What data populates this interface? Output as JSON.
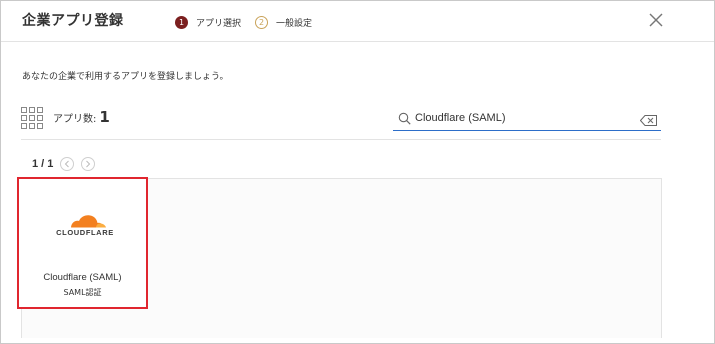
{
  "header": {
    "title": "企業アプリ登録",
    "steps": [
      {
        "num": "1",
        "label": "アプリ選択"
      },
      {
        "num": "2",
        "label": "一般設定"
      }
    ]
  },
  "main": {
    "description": "あなたの企業で利用するアプリを登録しましょう。",
    "app_count_label": "アプリ数:",
    "app_count": "1",
    "search": {
      "value": "Cloudflare (SAML)",
      "placeholder": ""
    },
    "pager": {
      "text": "1 / 1"
    },
    "apps": [
      {
        "logo_text": "CLOUDFLARE",
        "name": "Cloudflare (SAML)",
        "type": "SAML認証"
      }
    ]
  },
  "colors": {
    "step_active": "#7b1f1f",
    "step_inactive": "#c9a35a",
    "search_underline": "#2c6ec9",
    "highlight_border": "#e0262f",
    "cloudflare_orange": "#f38020",
    "cloudflare_light_orange": "#fbad41"
  }
}
